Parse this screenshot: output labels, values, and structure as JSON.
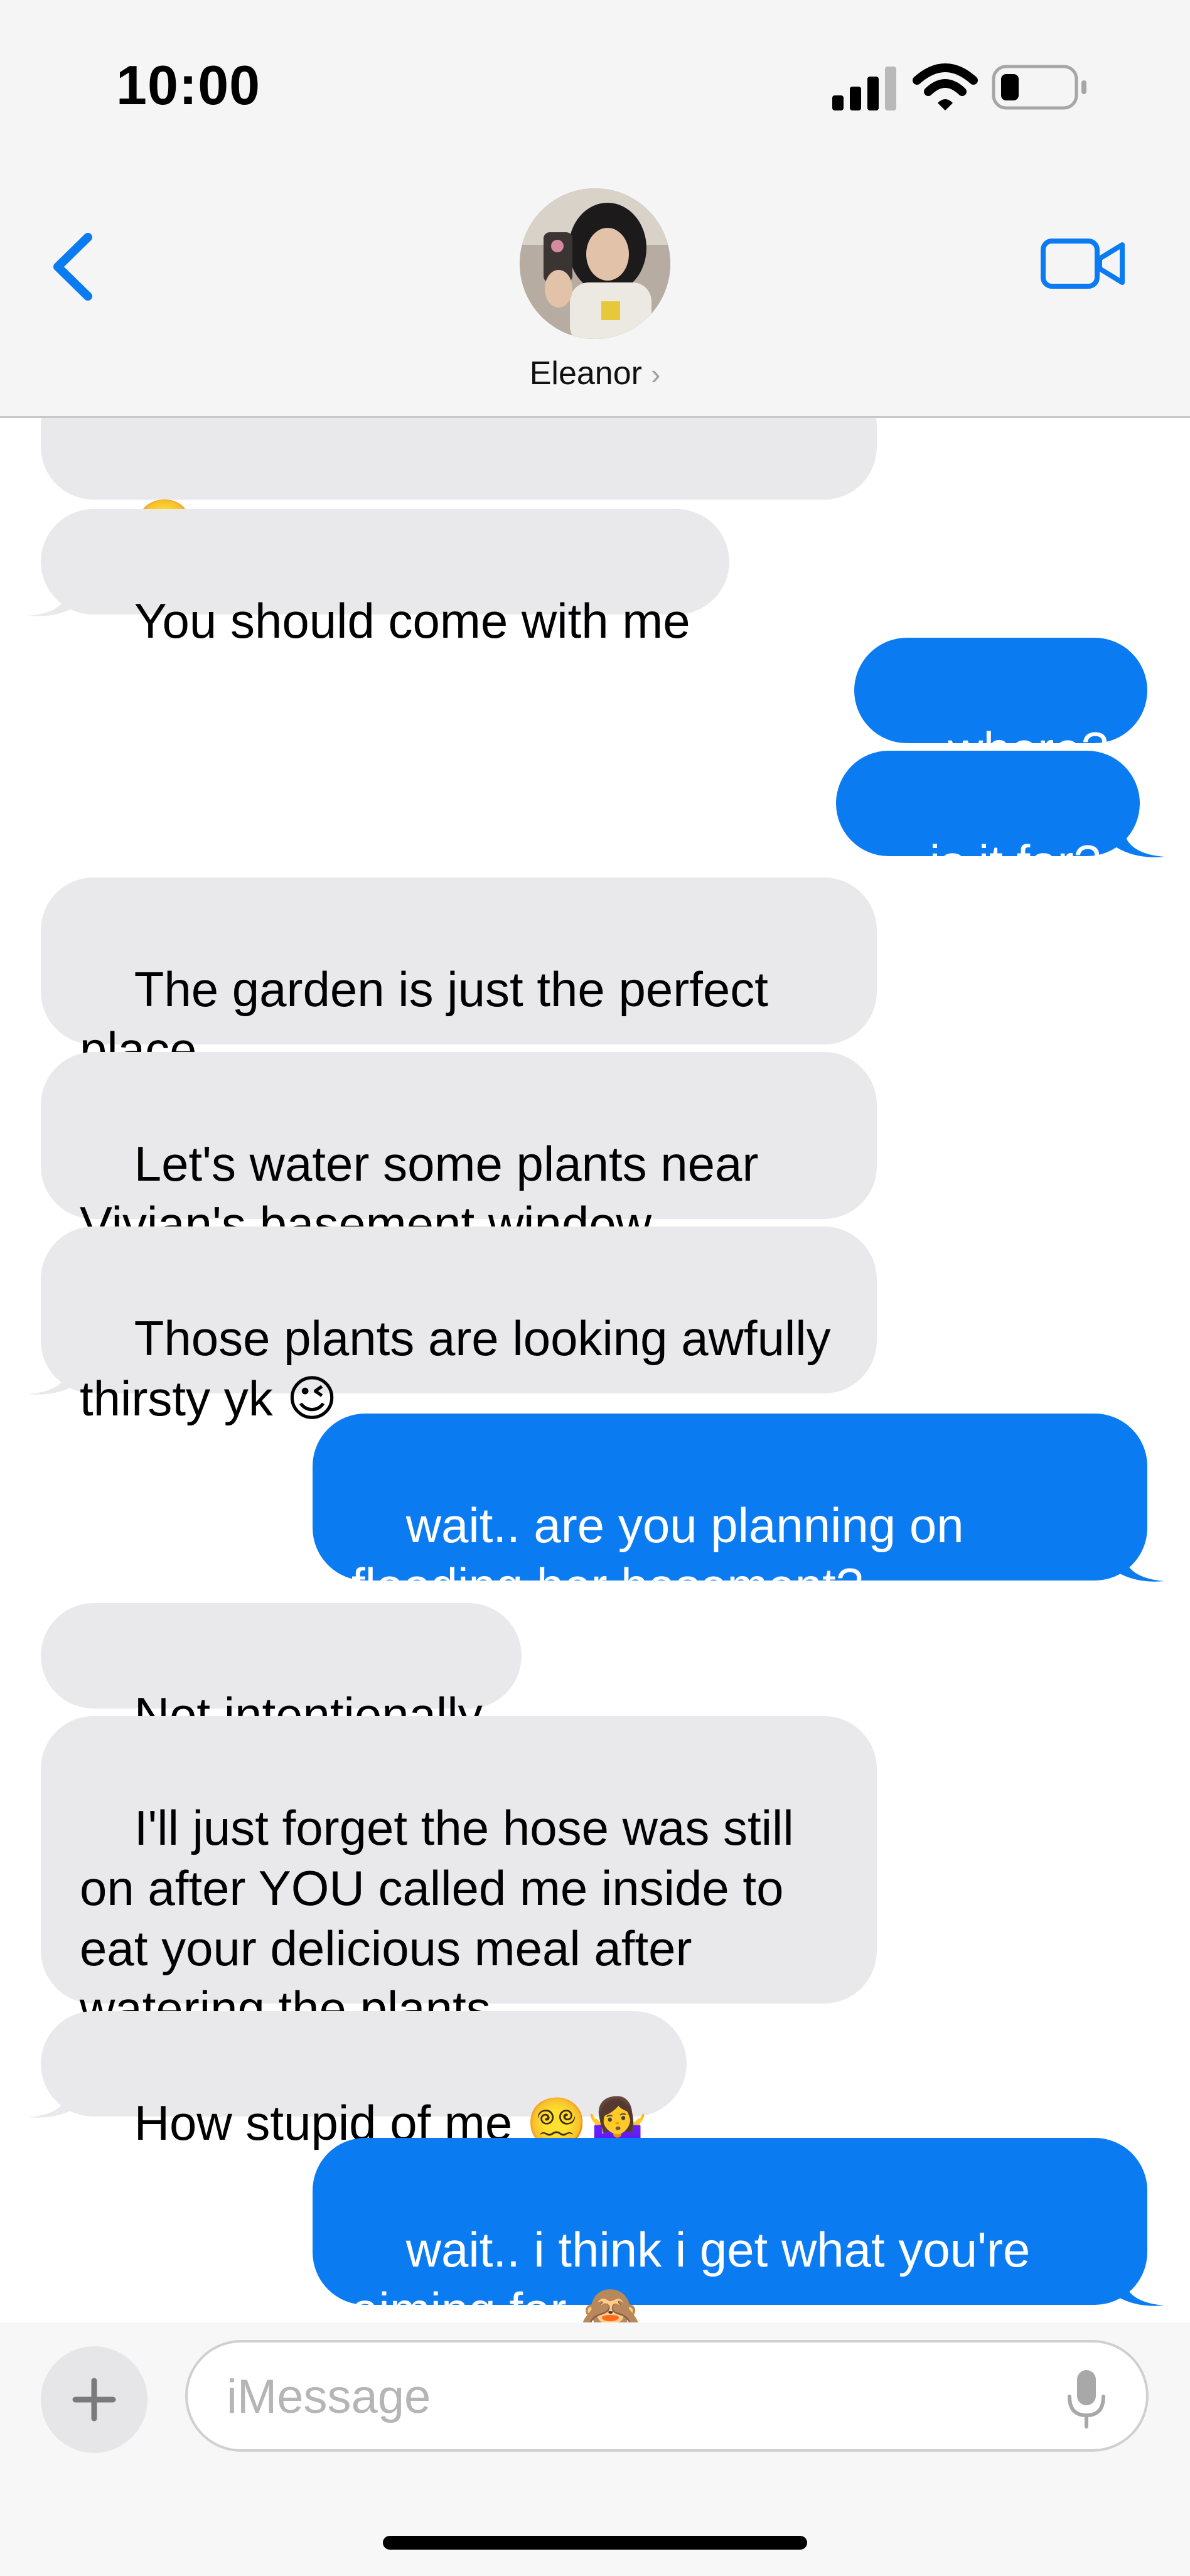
{
  "status_bar": {
    "time": "10:00"
  },
  "header": {
    "contact_name": "Eleanor",
    "chevron": "›"
  },
  "messages": [
    {
      "id": "m0",
      "dir": "in",
      "text": "🤭"
    },
    {
      "id": "m1",
      "dir": "in",
      "text": "You should come with me"
    },
    {
      "id": "m2",
      "dir": "out",
      "text": "where?"
    },
    {
      "id": "m3",
      "dir": "out",
      "text": "is it far?"
    },
    {
      "id": "m4",
      "dir": "in",
      "text": "The garden is just the perfect\nplace"
    },
    {
      "id": "m5",
      "dir": "in",
      "text": "Let's water some plants near\nVivian's basement window.."
    },
    {
      "id": "m6",
      "dir": "in",
      "text": "Those plants are looking awfully\nthirsty yk 😉"
    },
    {
      "id": "m7",
      "dir": "out",
      "text": "wait.. are you planning on\nflooding her basement?"
    },
    {
      "id": "m8",
      "dir": "in",
      "text": "Not intentionally"
    },
    {
      "id": "m9",
      "dir": "in",
      "text": "I'll just forget the hose was still\non after YOU called me inside to\neat your delicious meal after\nwatering the plants"
    },
    {
      "id": "m10",
      "dir": "in",
      "text": "How stupid of me 😵‍💫🤷‍♀️"
    },
    {
      "id": "m11",
      "dir": "out",
      "text": "wait.. i think i get what you're\naiming for 🙈"
    }
  ],
  "composer": {
    "placeholder": "iMessage",
    "value": ""
  },
  "icons": {
    "back": "chevron-left-icon",
    "video": "video-camera-icon",
    "plus": "plus-icon",
    "mic": "microphone-icon"
  },
  "colors": {
    "accent": "#0b7bf2",
    "incoming_bubble": "#e9e9eb",
    "header_bg": "#f5f5f5"
  }
}
